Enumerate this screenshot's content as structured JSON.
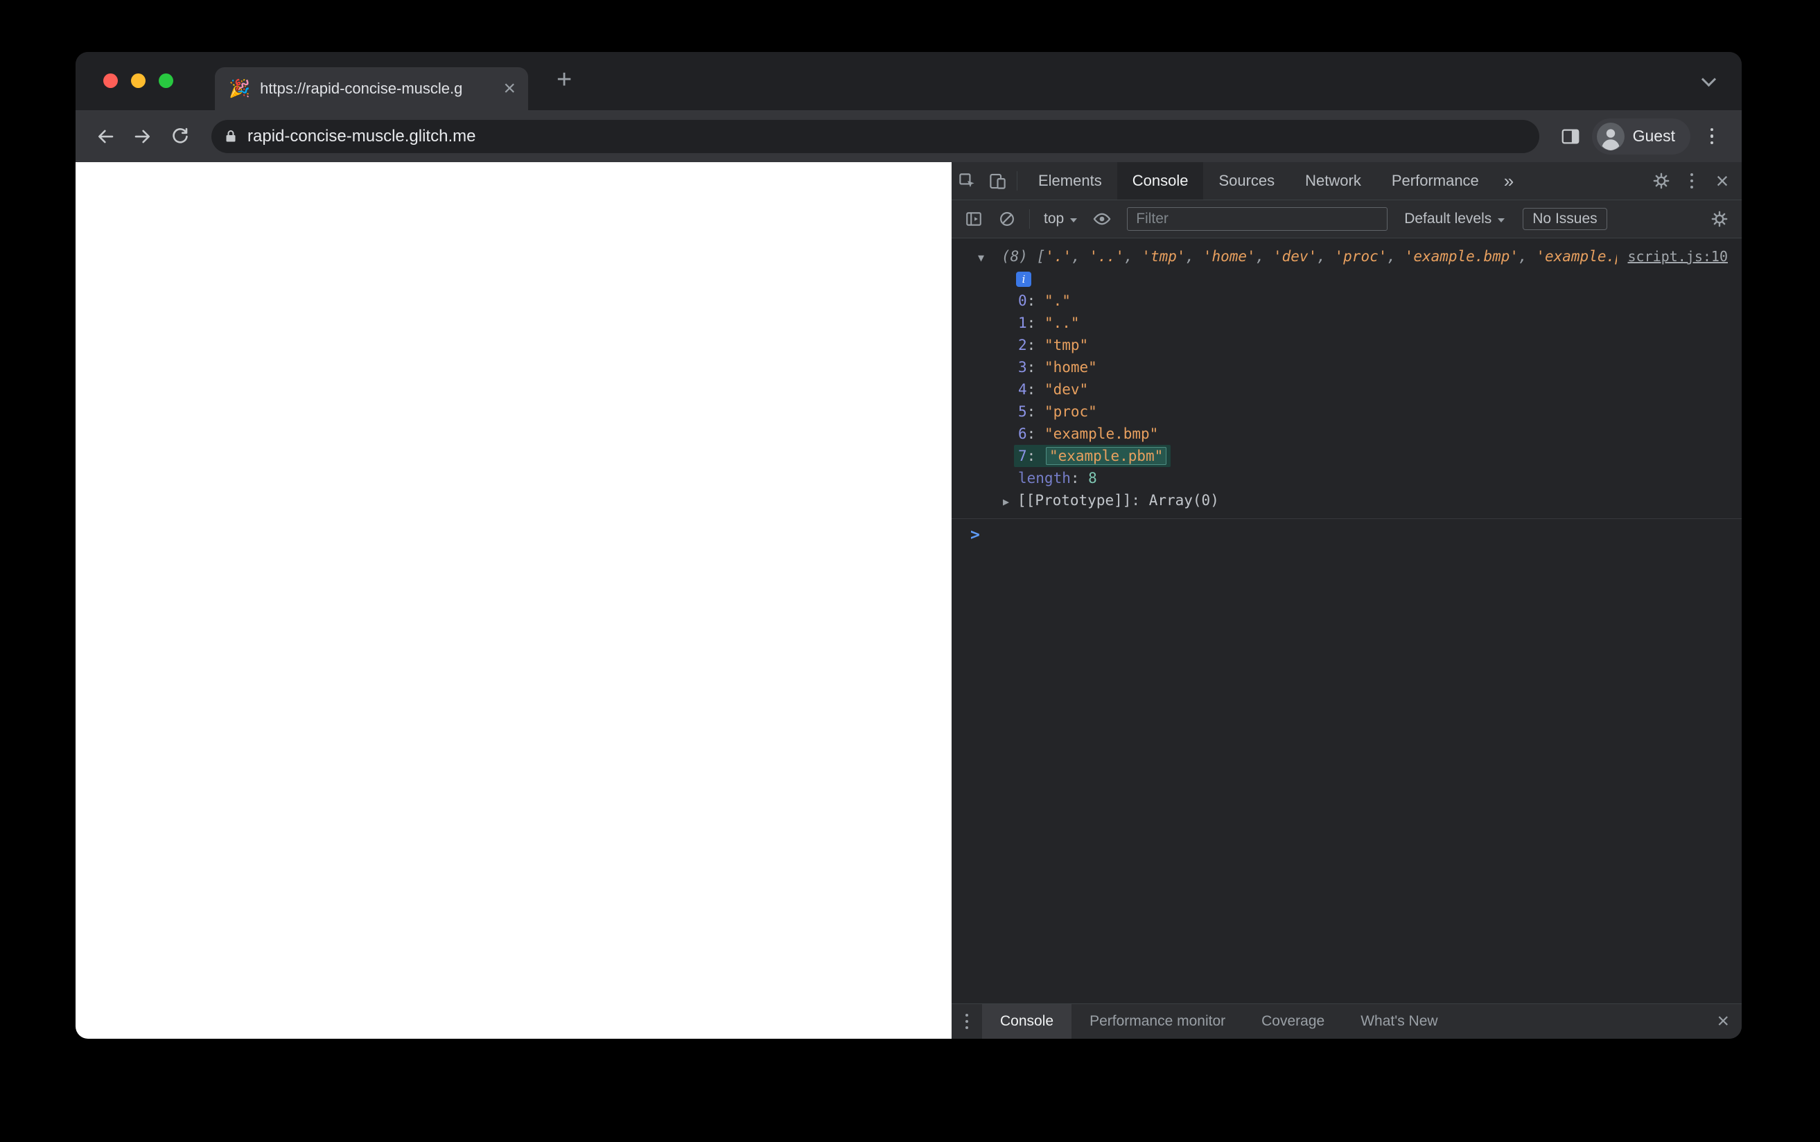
{
  "browser": {
    "tab": {
      "favicon": "🎉",
      "title": "https://rapid-concise-muscle.g"
    },
    "address": {
      "url": "rapid-concise-muscle.glitch.me"
    },
    "profile": {
      "label": "Guest"
    }
  },
  "devtools": {
    "panel_tabs": [
      {
        "label": "Elements",
        "active": false
      },
      {
        "label": "Console",
        "active": true
      },
      {
        "label": "Sources",
        "active": false
      },
      {
        "label": "Network",
        "active": false
      },
      {
        "label": "Performance",
        "active": false
      }
    ],
    "console_toolbar": {
      "context": "top",
      "filter_placeholder": "Filter",
      "levels": "Default levels",
      "issues": "No Issues"
    },
    "console": {
      "source_link": "script.js:10",
      "array_length_prefix": "(8)",
      "items": [
        ".",
        "..",
        "tmp",
        "home",
        "dev",
        "proc",
        "example.bmp",
        "example.pbm"
      ],
      "highlighted_index": 7,
      "length_label": "length",
      "length_value": "8",
      "prototype_label": "[[Prototype]]",
      "prototype_value": "Array(0)"
    },
    "drawer": {
      "tabs": [
        {
          "label": "Console",
          "active": true
        },
        {
          "label": "Performance monitor",
          "active": false
        },
        {
          "label": "Coverage",
          "active": false
        },
        {
          "label": "What's New",
          "active": false
        }
      ]
    }
  },
  "icons": {
    "tab_close": "×",
    "new_tab": "+",
    "more_tabs": "»",
    "devtools_close": "×",
    "drawer_close": "×",
    "prompt": ">",
    "disclosure_open": "▼",
    "disclosure_closed": "▶",
    "info": "i"
  },
  "colors": {
    "accent_blue": "#3b78e7",
    "string": "#e8a05f",
    "index": "#8b93e6",
    "number": "#7fc8b4",
    "muted": "#9aa0a6",
    "highlight_bg": "#1d423c",
    "highlight_border": "#4e8e83",
    "traffic_red": "#ff5f57",
    "traffic_yellow": "#febc2e",
    "traffic_green": "#28c840"
  }
}
